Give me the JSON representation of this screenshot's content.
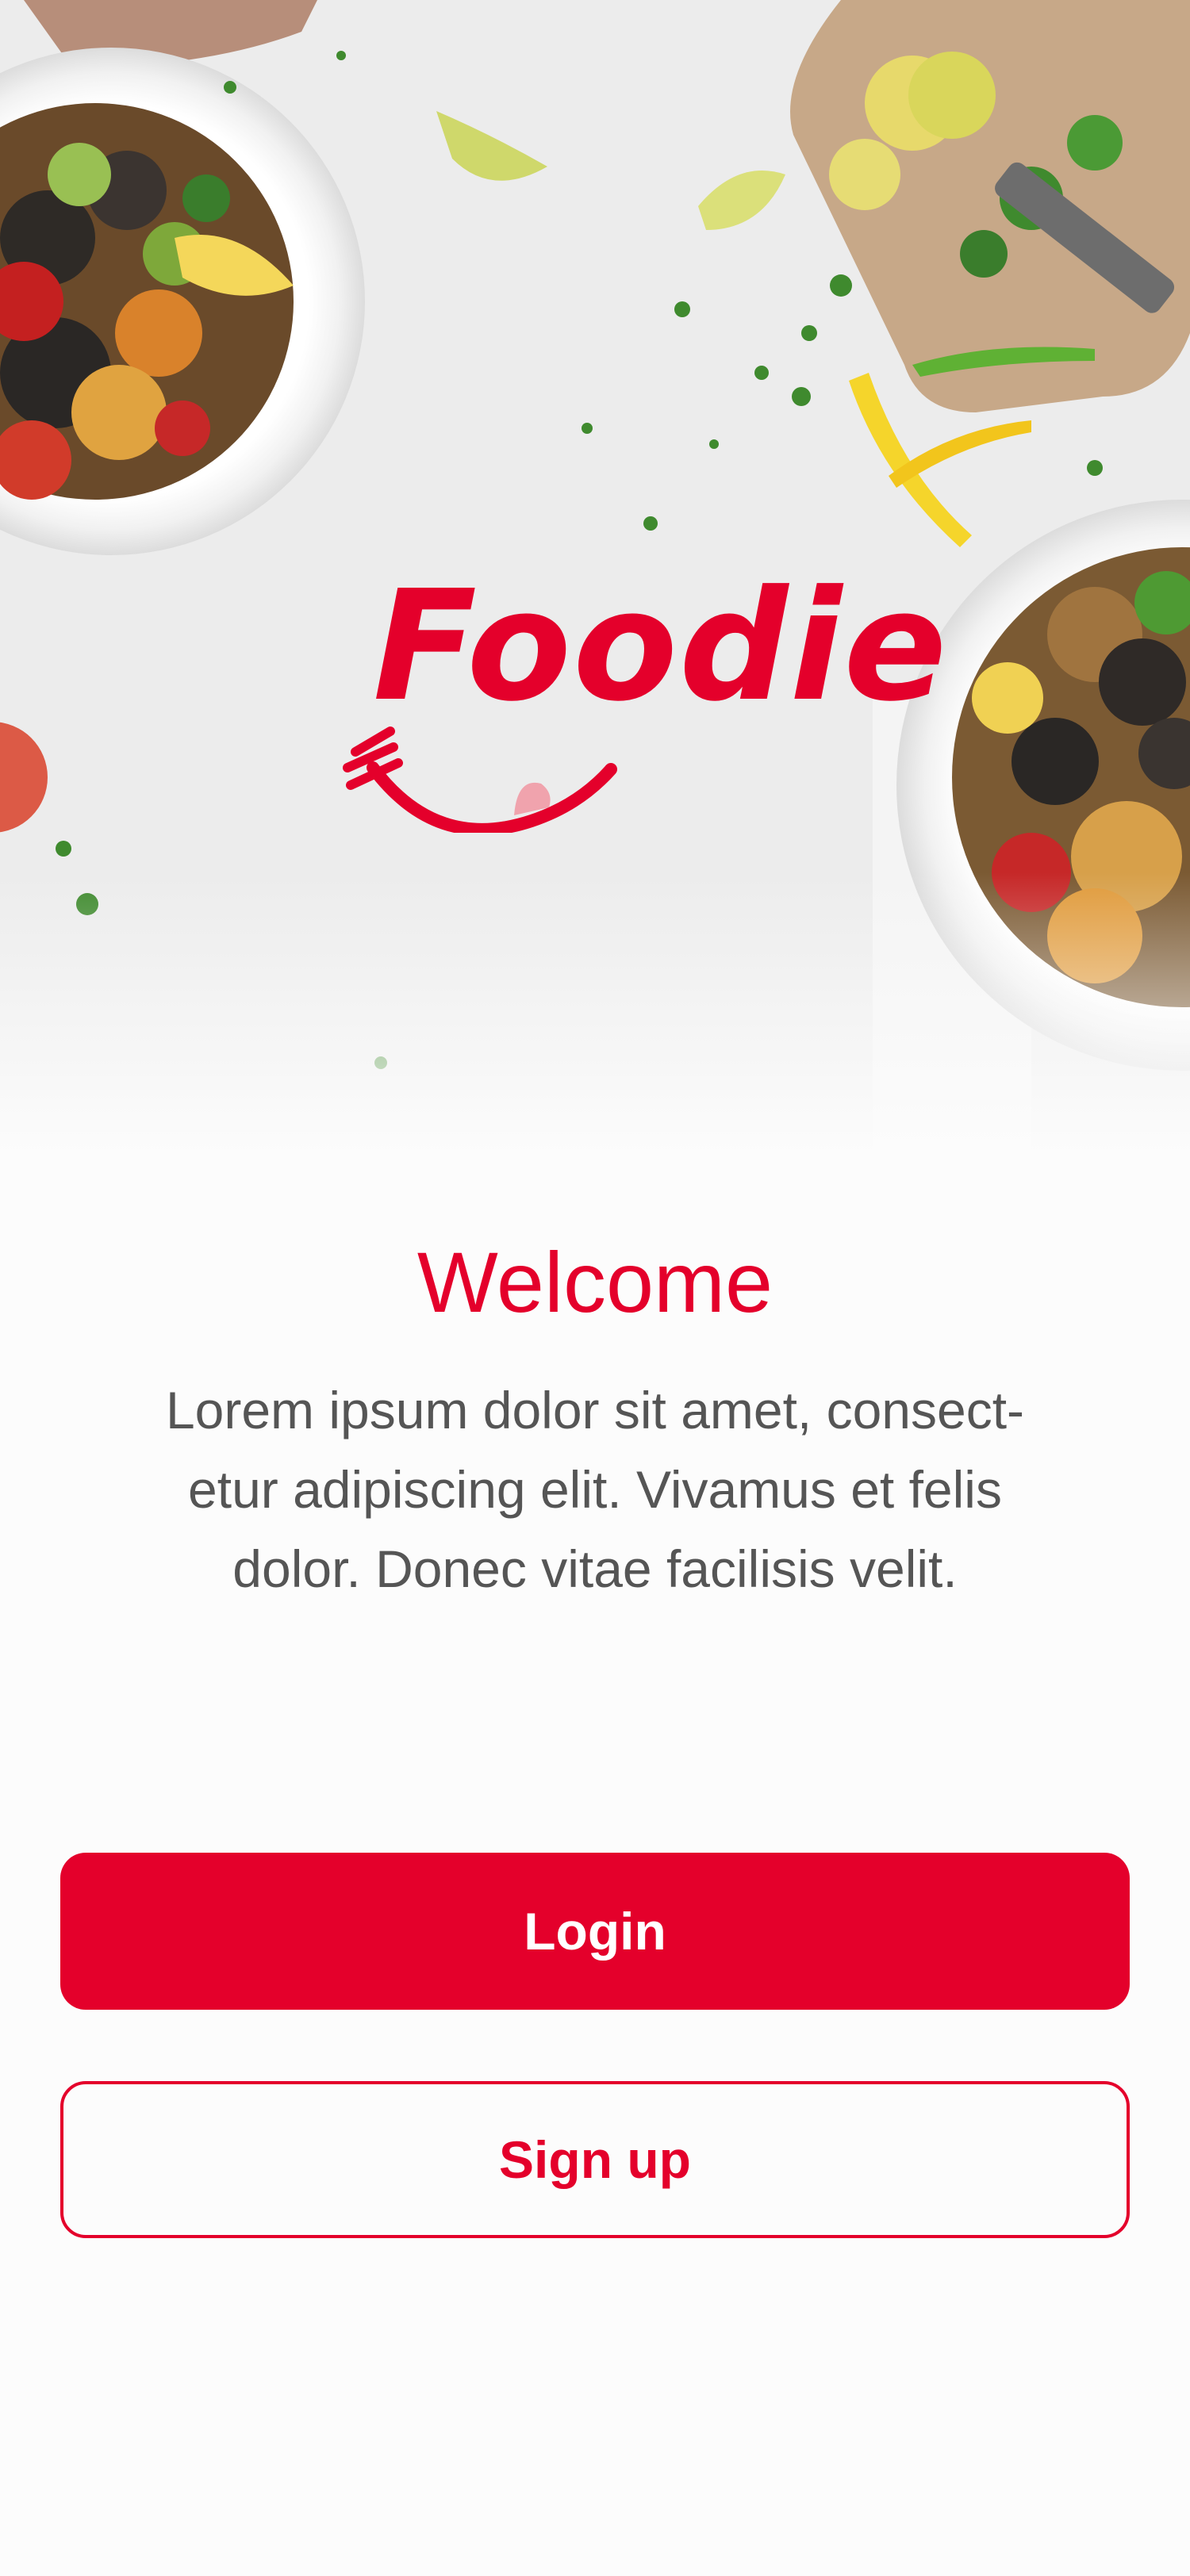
{
  "app": {
    "logo_text": "Foodie"
  },
  "welcome": {
    "title": "Welcome",
    "body_lines": [
      "Lorem ipsum dolor sit amet, consect-",
      "etur adipiscing elit. Vivamus et felis",
      "dolor. Donec vitae facilisis velit."
    ]
  },
  "actions": {
    "login_label": "Login",
    "signup_label": "Sign up"
  },
  "colors": {
    "brand": "#e4002b",
    "body_text": "#555555",
    "background": "#fcfcfc"
  },
  "icons": {
    "logo_mark": "fork-smile-icon"
  }
}
